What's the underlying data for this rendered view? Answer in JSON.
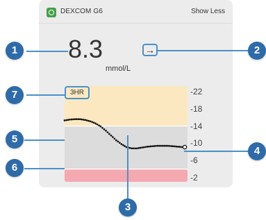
{
  "widget": {
    "app_name": "DEXCOM G6",
    "show_less_label": "Show Less",
    "reading_value": "8.3",
    "units": "mmol/L",
    "trend_arrow": "→",
    "trend_icon": "arrow-right-icon",
    "range_label": "3HR"
  },
  "callouts": {
    "c1": "1",
    "c2": "2",
    "c3": "3",
    "c4": "4",
    "c5": "5",
    "c6": "6",
    "c7": "7"
  },
  "chart_data": {
    "type": "scatter",
    "y_ticks": [
      "22",
      "18",
      "14",
      "10",
      "6",
      "2"
    ],
    "ylim": [
      2,
      22
    ],
    "bands": [
      {
        "name": "high",
        "from": 14,
        "to": 22,
        "color": "#fbe8c0"
      },
      {
        "name": "target",
        "from": 4,
        "to": 14,
        "color": "#dcdcdc"
      },
      {
        "name": "low",
        "from": 2,
        "to": 4,
        "color": "#f4a9b0"
      }
    ],
    "high_line": 14,
    "low_line": 4,
    "series": [
      {
        "values": [
          15.3,
          15.5,
          15.6,
          15.6,
          15.4,
          15.1,
          14.6,
          13.9,
          12.9,
          11.8,
          10.7,
          9.8,
          9.1,
          8.8,
          8.8,
          9.0,
          9.2,
          9.3,
          9.4,
          9.4,
          9.4,
          9.3,
          9.2,
          9.1
        ]
      }
    ],
    "current_value": 8.3,
    "colors": {
      "dots": "#111111",
      "accent": "#4a90c9",
      "callout": "#2e6ba8"
    }
  }
}
